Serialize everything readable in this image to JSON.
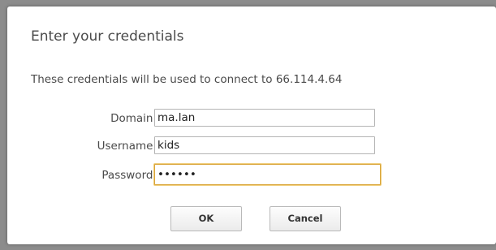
{
  "dialog": {
    "title": "Enter your credentials",
    "description": "These credentials will be used to connect to 66.114.4.64"
  },
  "form": {
    "domain": {
      "label": "Domain:",
      "value": "ma.lan"
    },
    "username": {
      "label": "Username:",
      "value": "kids"
    },
    "password": {
      "label": "Password:",
      "value": "••••••"
    }
  },
  "buttons": {
    "ok_label": "OK",
    "cancel_label": "Cancel"
  },
  "colors": {
    "backdrop": "#8c8c8c",
    "dialog_bg": "#ffffff",
    "focus_border": "#d9a53a",
    "text": "#4a4a4a"
  }
}
